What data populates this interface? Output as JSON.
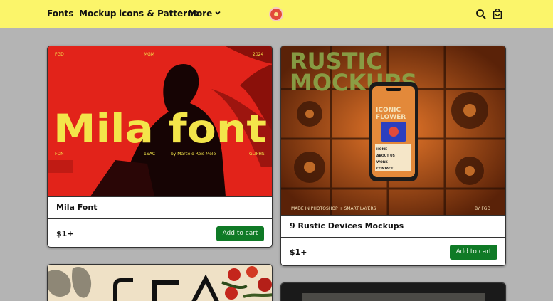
{
  "nav": {
    "items": [
      {
        "label": "Fonts"
      },
      {
        "label": "Mockup"
      },
      {
        "label": "icons & Patterns"
      },
      {
        "label": "More"
      }
    ]
  },
  "header_icons": {
    "search": "search-icon",
    "cart": "shopping-bag-icon",
    "logo": "brand-logo"
  },
  "products": [
    {
      "title": "Mila Font",
      "price": "$1+",
      "button": "Add to cart",
      "image": {
        "top_left": "FGD",
        "top_center": "MGM",
        "top_right": "2024",
        "headline": "Mila font",
        "bottom_left": "FONT",
        "bottom_mid": "1SAC",
        "byline": "by Marcelo Reis Melo",
        "bottom_right": "GLIPHS"
      }
    },
    {
      "title": "9 Rustic Devices Mockups",
      "price": "$1+",
      "button": "Add to cart",
      "image": {
        "headline_1": "RUSTIC",
        "headline_2": "MOCKUPS",
        "phone_title_1": "ICONIC",
        "phone_title_2": "FLOWER",
        "phone_menu": [
          "HOME",
          "ABOUT US",
          "WORK",
          "CONTACT"
        ],
        "footer_left": "MADE IN PHOTOSHOP + SMART LAYERS",
        "footer_right": "BY FGD"
      }
    }
  ],
  "colors": {
    "header_bg": "#fbf56a",
    "page_bg": "#b4b4b4",
    "button_bg": "#0f7a26",
    "mila_bg": "#e2231a",
    "mila_text": "#f3e54a"
  }
}
